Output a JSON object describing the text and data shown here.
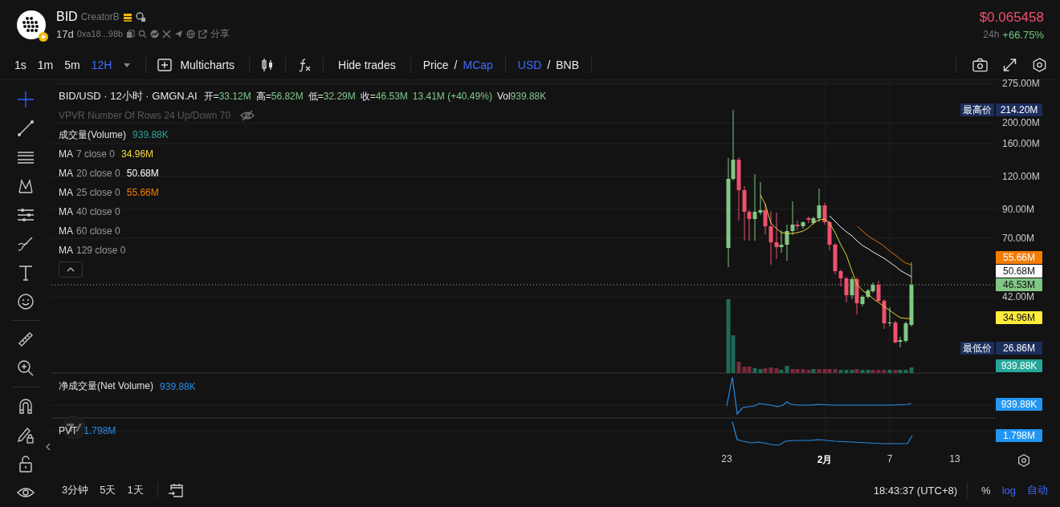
{
  "header": {
    "symbol": "BID",
    "creator": "CreatorB",
    "age": "17d",
    "address": "0xa18...98b",
    "share": "分享",
    "price": "$0.065458",
    "change_label": "24h",
    "change": "+66.75%"
  },
  "toolbar": {
    "intervals": [
      {
        "label": "1s",
        "selected": false
      },
      {
        "label": "1m",
        "selected": false
      },
      {
        "label": "5m",
        "selected": false
      },
      {
        "label": "12H",
        "selected": true
      }
    ],
    "multicharts": "Multicharts",
    "hide_trades": "Hide trades",
    "toggles": [
      {
        "separator": "/",
        "options": [
          {
            "label": "Price",
            "selected": false
          },
          {
            "label": "MCap",
            "selected": true
          }
        ]
      },
      {
        "separator": "/",
        "options": [
          {
            "label": "USD",
            "selected": true
          },
          {
            "label": "BNB",
            "selected": false
          }
        ]
      }
    ]
  },
  "legend": {
    "title": "BID/USD · 12小时 · GMGN.AI",
    "ohlc": [
      {
        "label": "开=",
        "value": "33.12M"
      },
      {
        "label": "高=",
        "value": "56.82M"
      },
      {
        "label": "低=",
        "value": "32.29M"
      },
      {
        "label": "收=",
        "value": "46.53M"
      }
    ],
    "change": "13.41M (+40.49%)",
    "vol_label": "Vol",
    "vol_value": "939.88K",
    "vpvr": "VPVR Number Of Rows 24 Up/Down 70",
    "indicators": [
      {
        "name": "成交量(Volume)",
        "value": "939.88K",
        "color": "#26a69a"
      },
      {
        "name": "MA",
        "params": "7 close 0",
        "value": "34.96M",
        "color": "#f5dc3c"
      },
      {
        "name": "MA",
        "params": "20 close 0",
        "value": "50.68M",
        "color": "#ffffff"
      },
      {
        "name": "MA",
        "params": "25 close 0",
        "value": "55.66M",
        "color": "#f57c00"
      },
      {
        "name": "MA",
        "params": "40 close 0"
      },
      {
        "name": "MA",
        "params": "60 close 0"
      },
      {
        "name": "MA",
        "params": "129 close 0"
      }
    ]
  },
  "net_volume": {
    "label": "净成交量(Net Volume)",
    "value": "939.88K"
  },
  "pvt": {
    "label": "PVT",
    "value": "1.798M"
  },
  "price_axis": {
    "ticks": [
      "275.00M",
      "200.00M",
      "160.00M",
      "120.00M",
      "90.00M",
      "70.00M",
      "42.00M"
    ],
    "badges": [
      {
        "tag": "最高价",
        "value": "214.20M",
        "color": "#1c2e5c"
      },
      {
        "value": "55.66M",
        "color": "#f57c00"
      },
      {
        "value": "50.68M",
        "color": "#ffffff"
      },
      {
        "value": "46.53M",
        "color": "#81c784"
      },
      {
        "value": "34.96M",
        "color": "#ffeb3b"
      },
      {
        "tag": "最低价",
        "value": "26.86M",
        "color": "#1c2e5c"
      },
      {
        "value": "939.88K",
        "color": "#26a69a"
      },
      {
        "value": "939.88K",
        "color": "#2196f3"
      },
      {
        "value": "1.798M",
        "color": "#2196f3"
      }
    ]
  },
  "time_axis": [
    {
      "text": "23",
      "bold": false
    },
    {
      "text": "2月",
      "bold": true
    },
    {
      "text": "7",
      "bold": false
    },
    {
      "text": "13",
      "bold": false
    }
  ],
  "bottom_bar": {
    "ranges": [
      "3分钟",
      "5天",
      "1天"
    ],
    "clock": "18:43:37 (UTC+8)",
    "scale_options": [
      {
        "label": "%",
        "selected": false
      },
      {
        "label": "log",
        "selected": true
      },
      {
        "label": "自动",
        "selected": true
      }
    ]
  }
}
